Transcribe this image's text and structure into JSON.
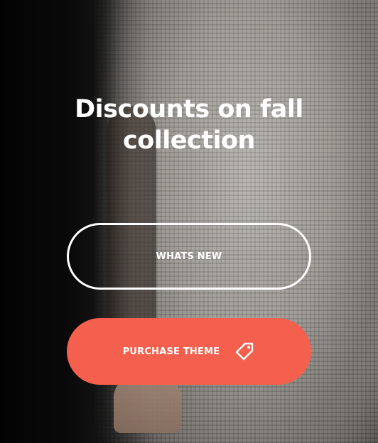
{
  "hero": {
    "title_line1": "Discounts on fall",
    "title_line2": "collection"
  },
  "buttons": {
    "whats_new_label": "WHATS NEW",
    "purchase_label": "PURCHASE THEME",
    "purchase_icon": "tag-icon"
  },
  "colors": {
    "accent": "#f4604d",
    "text": "#ffffff"
  }
}
